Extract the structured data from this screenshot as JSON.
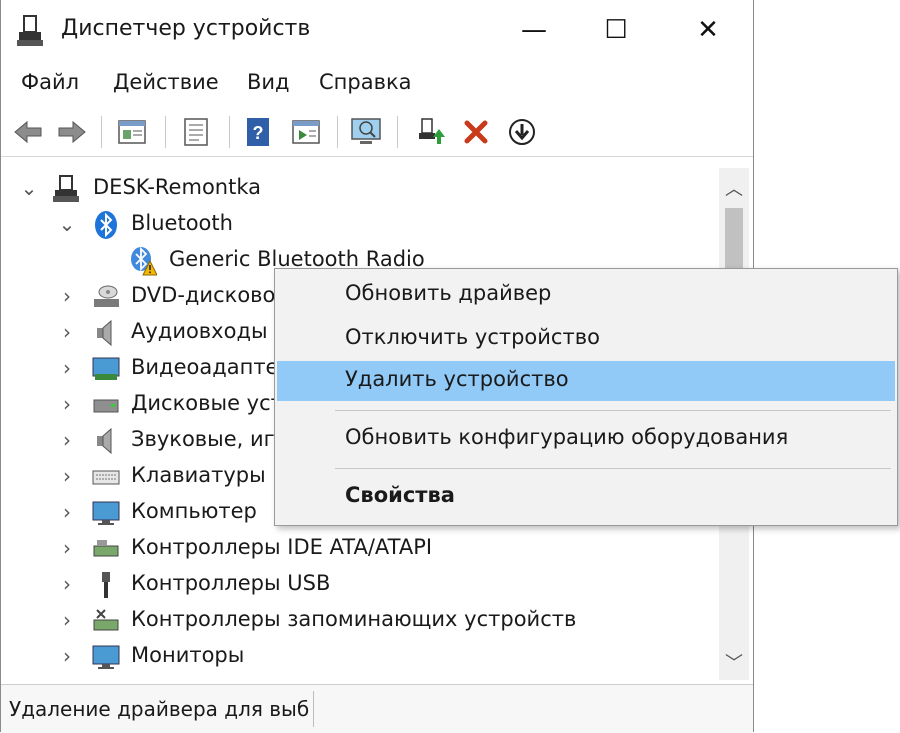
{
  "window": {
    "title": "Диспетчер устройств",
    "controls": {
      "minimize": "—",
      "maximize": "☐",
      "close": "✕"
    }
  },
  "menu": [
    "Файл",
    "Действие",
    "Вид",
    "Справка"
  ],
  "toolbar": {
    "buttons": [
      "back-icon",
      "forward-icon",
      "properties-icon",
      "list-icon",
      "help-icon",
      "view-icon",
      "monitor-icon",
      "update-driver-icon",
      "delete-icon",
      "download-icon"
    ]
  },
  "tree": {
    "root": "DESK-Remontka",
    "items": [
      {
        "label": "Bluetooth",
        "expanded": true
      },
      {
        "label": "Generic Bluetooth Radio",
        "child": true
      },
      {
        "label": "DVD-дисково"
      },
      {
        "label": "Аудиовходы и"
      },
      {
        "label": "Видеоадаптер"
      },
      {
        "label": "Дисковые уст"
      },
      {
        "label": "Звуковые, иг"
      },
      {
        "label": "Клавиатуры"
      },
      {
        "label": "Компьютер"
      },
      {
        "label": "Контроллеры IDE ATA/ATAPI"
      },
      {
        "label": "Контроллеры USB"
      },
      {
        "label": "Контроллеры запоминающих устройств"
      },
      {
        "label": "Мониторы"
      }
    ]
  },
  "context_menu": {
    "items": [
      {
        "label": "Обновить драйвер"
      },
      {
        "label": "Отключить устройство"
      },
      {
        "label": "Удалить устройство",
        "highlighted": true
      },
      {
        "label": "Обновить конфигурацию оборудования"
      },
      {
        "label": "Свойства",
        "bold": true
      }
    ]
  },
  "status": {
    "text": "Удаление драйвера для выб"
  },
  "colors": {
    "highlight": "#91c9f7",
    "warning": "#f5b800",
    "bluetooth": "#1e74d8",
    "delete": "#c83a1a"
  }
}
